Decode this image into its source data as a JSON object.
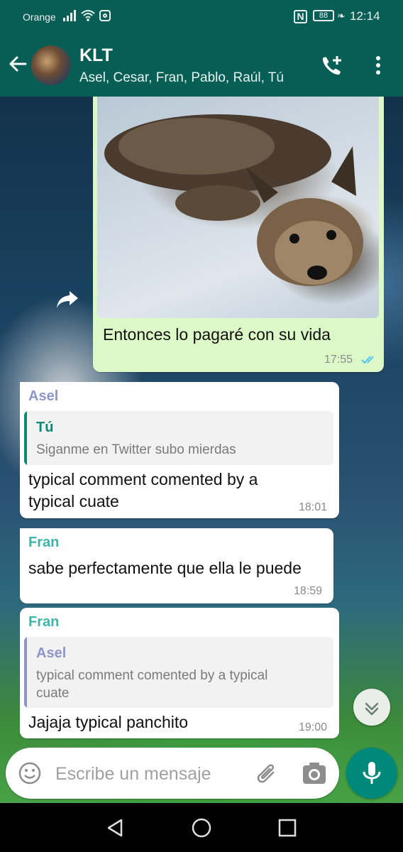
{
  "status_bar": {
    "carrier": "Orange",
    "battery": "88",
    "time": "12:14"
  },
  "header": {
    "title": "KLT",
    "subtitle": "Asel, Cesar, Fran, Pablo, Raúl, Tú"
  },
  "messages": [
    {
      "type": "outgoing-image",
      "caption": "Entonces lo pagaré con su vida",
      "time": "17:55",
      "status": "read"
    },
    {
      "type": "incoming",
      "sender": "Asel",
      "sender_color": "#8e96c8",
      "quote": {
        "name": "Tú",
        "name_color": "#0b8a72",
        "text": "Siganme en Twitter subo mierdas"
      },
      "lines": [
        "typical comment comented by a",
        "typical cuate"
      ],
      "time": "18:01"
    },
    {
      "type": "incoming",
      "sender": "Fran",
      "sender_color": "#3fb5a8",
      "lines": [
        "sabe perfectamente que ella le puede"
      ],
      "time": "18:59"
    },
    {
      "type": "incoming",
      "sender": "Fran",
      "sender_color": "#3fb5a8",
      "quote": {
        "name": "Asel",
        "name_color": "#8e96c8",
        "lines": [
          "typical comment comented by a typical",
          "cuate"
        ]
      },
      "lines": [
        "Jajaja typical panchito"
      ],
      "time": "19:00"
    }
  ],
  "composer": {
    "placeholder": "Escribe un mensaje"
  },
  "colors": {
    "header_bg": "#075e54",
    "outgoing_bubble": "#dcf8c6",
    "accent": "#00897b",
    "read_ticks": "#4fc3f7"
  },
  "icons": [
    "back-arrow-icon",
    "add-call-icon",
    "more-vert-icon",
    "forward-icon",
    "scroll-down-icon",
    "emoji-icon",
    "attach-icon",
    "camera-icon",
    "mic-icon",
    "nav-back-icon",
    "nav-home-icon",
    "nav-recents-icon"
  ]
}
